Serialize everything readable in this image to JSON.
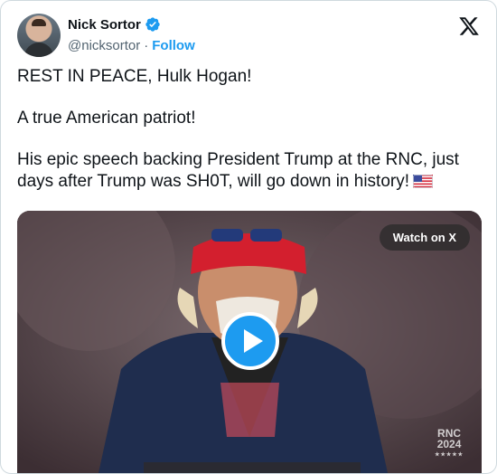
{
  "author": {
    "name": "Nick Sortor",
    "handle": "@nicksortor",
    "separator": "·",
    "follow_label": "Follow"
  },
  "tweet": {
    "line1": "REST IN PEACE, Hulk Hogan!",
    "line2": "A true American patriot!",
    "line3": "His epic speech backing President Trump at the RNC, just days after Trump was SH0T, will go down in history!"
  },
  "media": {
    "watch_label": "Watch on X",
    "event_line1": "RNC",
    "event_line2": "2024",
    "event_stars": "★★★★★"
  },
  "colors": {
    "link": "#1d9bf0",
    "text": "#0f1419",
    "muted": "#536471"
  },
  "icons": [
    "verified-badge-icon",
    "x-logo-icon",
    "us-flag-icon",
    "play-icon"
  ]
}
